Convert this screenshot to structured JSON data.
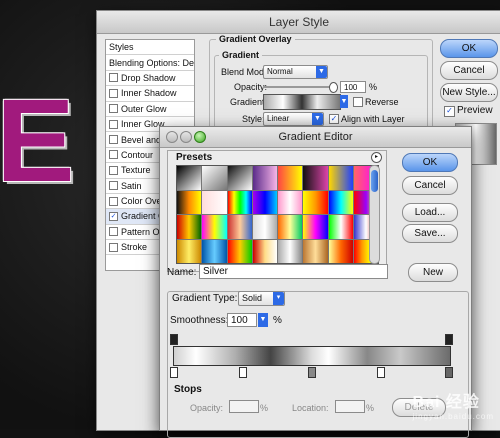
{
  "background": {
    "letter": "E",
    "letter_color": "#a11a7d"
  },
  "layer_style": {
    "title": "Layer Style",
    "list_items": [
      {
        "label": "Styles",
        "header": true
      },
      {
        "label": "Blending Options: Default",
        "header": true
      },
      {
        "label": "Drop Shadow",
        "checked": false
      },
      {
        "label": "Inner Shadow",
        "checked": false
      },
      {
        "label": "Outer Glow",
        "checked": false
      },
      {
        "label": "Inner Glow",
        "checked": false
      },
      {
        "label": "Bevel and Emboss",
        "checked": false
      },
      {
        "label": "Contour",
        "checked": false
      },
      {
        "label": "Texture",
        "checked": false
      },
      {
        "label": "Satin",
        "checked": false
      },
      {
        "label": "Color Overlay",
        "checked": false
      },
      {
        "label": "Gradient Overlay",
        "checked": true
      },
      {
        "label": "Pattern Overlay",
        "checked": false
      },
      {
        "label": "Stroke",
        "checked": false
      }
    ],
    "group_title": "Gradient Overlay",
    "subgroup_title": "Gradient",
    "blend_mode_label": "Blend Mode:",
    "blend_mode_value": "Normal",
    "opacity_label": "Opacity:",
    "opacity_value": "100",
    "opacity_unit": "%",
    "gradient_label": "Gradient:",
    "reverse_label": "Reverse",
    "style_label": "Style:",
    "style_value": "Linear",
    "align_label": "Align with Layer",
    "ok_label": "OK",
    "cancel_label": "Cancel",
    "new_style_label": "New Style...",
    "preview_label": "Preview"
  },
  "gradient_editor": {
    "title": "Gradient Editor",
    "presets_label": "Presets",
    "ok_label": "OK",
    "cancel_label": "Cancel",
    "load_label": "Load...",
    "save_label": "Save...",
    "name_label": "Name:",
    "name_value": "Silver",
    "new_label": "New",
    "gradient_type_label": "Gradient Type:",
    "gradient_type_value": "Solid",
    "smoothness_label": "Smoothness:",
    "smoothness_value": "100",
    "smoothness_unit": "%",
    "stops_label": "Stops",
    "opacity_label": "Opacity:",
    "opacity_unit": "%",
    "location_label": "Location:",
    "location_unit": "%",
    "delete_label": "Delete",
    "presets": [
      "linear-gradient(135deg,#000,#fff)",
      "linear-gradient(135deg,#fff,#fff0)",
      "linear-gradient(135deg,#111,#fff)",
      "linear-gradient(90deg,#5b2c8a,#f6b4e8)",
      "linear-gradient(90deg,#f44,#ff0)",
      "linear-gradient(90deg,#111,#d4a)",
      "linear-gradient(90deg,#ffd700,#1e40ff)",
      "linear-gradient(90deg,#f66,#f0f)",
      "linear-gradient(90deg,#111,#f80,#ff0)",
      "linear-gradient(90deg,#fdd,#fff)",
      "linear-gradient(90deg,#f00,#ff0,#0f0,#0ff,#00f)",
      "linear-gradient(90deg,#a0e,#00f,#0cf)",
      "linear-gradient(90deg,#f9c,#fff,#f9c)",
      "linear-gradient(90deg,#ff0,#f90,#f00)",
      "linear-gradient(90deg,#00f,#0ff,#ff0)",
      "linear-gradient(90deg,#f00,#90f,#ff0)",
      "linear-gradient(90deg,#c00,#fc0,#060)",
      "linear-gradient(90deg,#f0f,#ff0,#0ff)",
      "linear-gradient(90deg,#c33,#fc9,#36c)",
      "linear-gradient(90deg,#ddd,#fff,#aaa)",
      "linear-gradient(90deg,#f60,#ff9,#0c6)",
      "linear-gradient(90deg,#ff0,#f0f,#00f)",
      "linear-gradient(90deg,#0f0,#fff,#f00)",
      "linear-gradient(90deg,#33c,#fff,#c33)",
      "linear-gradient(90deg,#c80,#fe6,#c80)",
      "linear-gradient(90deg,#05a,#6cf,#05a)",
      "linear-gradient(90deg,#f00,#fc0,#0c0)",
      "linear-gradient(90deg,#c00,#fd8,#fff)",
      "linear-gradient(90deg,#aaa,#fff,#888)",
      "linear-gradient(90deg,#b73,#fd9,#a62)",
      "linear-gradient(90deg,#ff9,#f60,#c00)",
      "linear-gradient(90deg,#f00,#f90,#ff0,#0c0)"
    ]
  },
  "watermark": {
    "text": "Bai 经验",
    "sub": "jingyan.baidu.com"
  }
}
